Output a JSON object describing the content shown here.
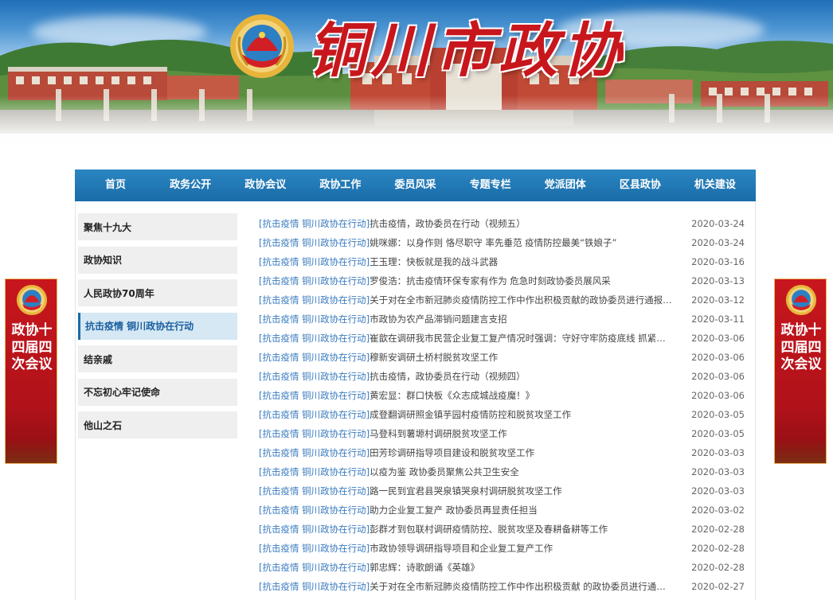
{
  "site": {
    "title": "铜川市政协"
  },
  "nav": [
    "首页",
    "政务公开",
    "政协会议",
    "政协工作",
    "委员风采",
    "专题专栏",
    "党派团体",
    "区县政协",
    "机关建设"
  ],
  "sidebar": [
    {
      "label": "聚焦十九大",
      "active": false
    },
    {
      "label": "政协知识",
      "active": false
    },
    {
      "label": "人民政协70周年",
      "active": false
    },
    {
      "label": "抗击疫情  铜川政协在行动",
      "active": true
    },
    {
      "label": "结亲戚",
      "active": false
    },
    {
      "label": "不忘初心牢记使命",
      "active": false
    },
    {
      "label": "他山之石",
      "active": false
    }
  ],
  "articles": [
    {
      "category": "[抗击疫情 铜川政协在行动]",
      "title": "抗击疫情，政协委员在行动（视频五）",
      "date": "2020-03-24"
    },
    {
      "category": "[抗击疫情 铜川政协在行动]",
      "title": "姚咪娜：以身作则 恪尽职守 率先垂范 疫情防控最美“铁娘子”",
      "date": "2020-03-24"
    },
    {
      "category": "[抗击疫情 铜川政协在行动]",
      "title": "王玉理：快板就是我的战斗武器",
      "date": "2020-03-16"
    },
    {
      "category": "[抗击疫情 铜川政协在行动]",
      "title": "罗俊浩：抗击疫情环保专家有作为 危急时刻政协委员展风采",
      "date": "2020-03-13"
    },
    {
      "category": "[抗击疫情 铜川政协在行动]",
      "title": "关于对在全市新冠肺炎疫情防控工作中作出积极贡献的政协委员进行通报表彰...",
      "date": "2020-03-12"
    },
    {
      "category": "[抗击疫情 铜川政协在行动]",
      "title": "市政协为农产品滞销问题建言支招",
      "date": "2020-03-11"
    },
    {
      "category": "[抗击疫情 铜川政协在行动]",
      "title": "崔歆在调研我市民营企业复工复产情况时强调：守好守牢防疫底线 抓紧复工...",
      "date": "2020-03-06"
    },
    {
      "category": "[抗击疫情 铜川政协在行动]",
      "title": "穆新安调研土桥村脱贫攻坚工作",
      "date": "2020-03-06"
    },
    {
      "category": "[抗击疫情 铜川政协在行动]",
      "title": "抗击疫情，政协委员在行动（视频四）",
      "date": "2020-03-06"
    },
    {
      "category": "[抗击疫情 铜川政协在行动]",
      "title": "黄宏显：群口快板《众志成城战疫魔！》",
      "date": "2020-03-06"
    },
    {
      "category": "[抗击疫情 铜川政协在行动]",
      "title": "成登翻调研照金镇芋园村疫情防控和脱贫攻坚工作",
      "date": "2020-03-05"
    },
    {
      "category": "[抗击疫情 铜川政协在行动]",
      "title": "马登科到薯塬村调研脱贫攻坚工作",
      "date": "2020-03-05"
    },
    {
      "category": "[抗击疫情 铜川政协在行动]",
      "title": "田芳珍调研指导项目建设和脱贫攻坚工作",
      "date": "2020-03-03"
    },
    {
      "category": "[抗击疫情 铜川政协在行动]",
      "title": "以疫为鉴 政协委员聚焦公共卫生安全",
      "date": "2020-03-03"
    },
    {
      "category": "[抗击疫情 铜川政协在行动]",
      "title": "路一民到宜君县哭泉镇哭泉村调研脱贫攻坚工作",
      "date": "2020-03-03"
    },
    {
      "category": "[抗击疫情 铜川政协在行动]",
      "title": "助力企业复工复产 政协委员再显责任担当",
      "date": "2020-03-02"
    },
    {
      "category": "[抗击疫情 铜川政协在行动]",
      "title": "彭群才到包联村调研疫情防控、脱贫攻坚及春耕备耕等工作",
      "date": "2020-02-28"
    },
    {
      "category": "[抗击疫情 铜川政协在行动]",
      "title": "市政协领导调研指导项目和企业复工复产工作",
      "date": "2020-02-28"
    },
    {
      "category": "[抗击疫情 铜川政协在行动]",
      "title": "郭忠辉：诗歌朗诵《英雄》",
      "date": "2020-02-28"
    },
    {
      "category": "[抗击疫情 铜川政协在行动]",
      "title": "关于对在全市新冠肺炎疫情防控工作中作出积极贡献 的政协委员进行通报表...",
      "date": "2020-02-27"
    }
  ],
  "float_banner": {
    "text": "政协十四届四次会议"
  },
  "colors": {
    "brand_red": "#c8161d",
    "nav_blue": "#1a6ca8",
    "link_blue": "#3a7bbf"
  }
}
